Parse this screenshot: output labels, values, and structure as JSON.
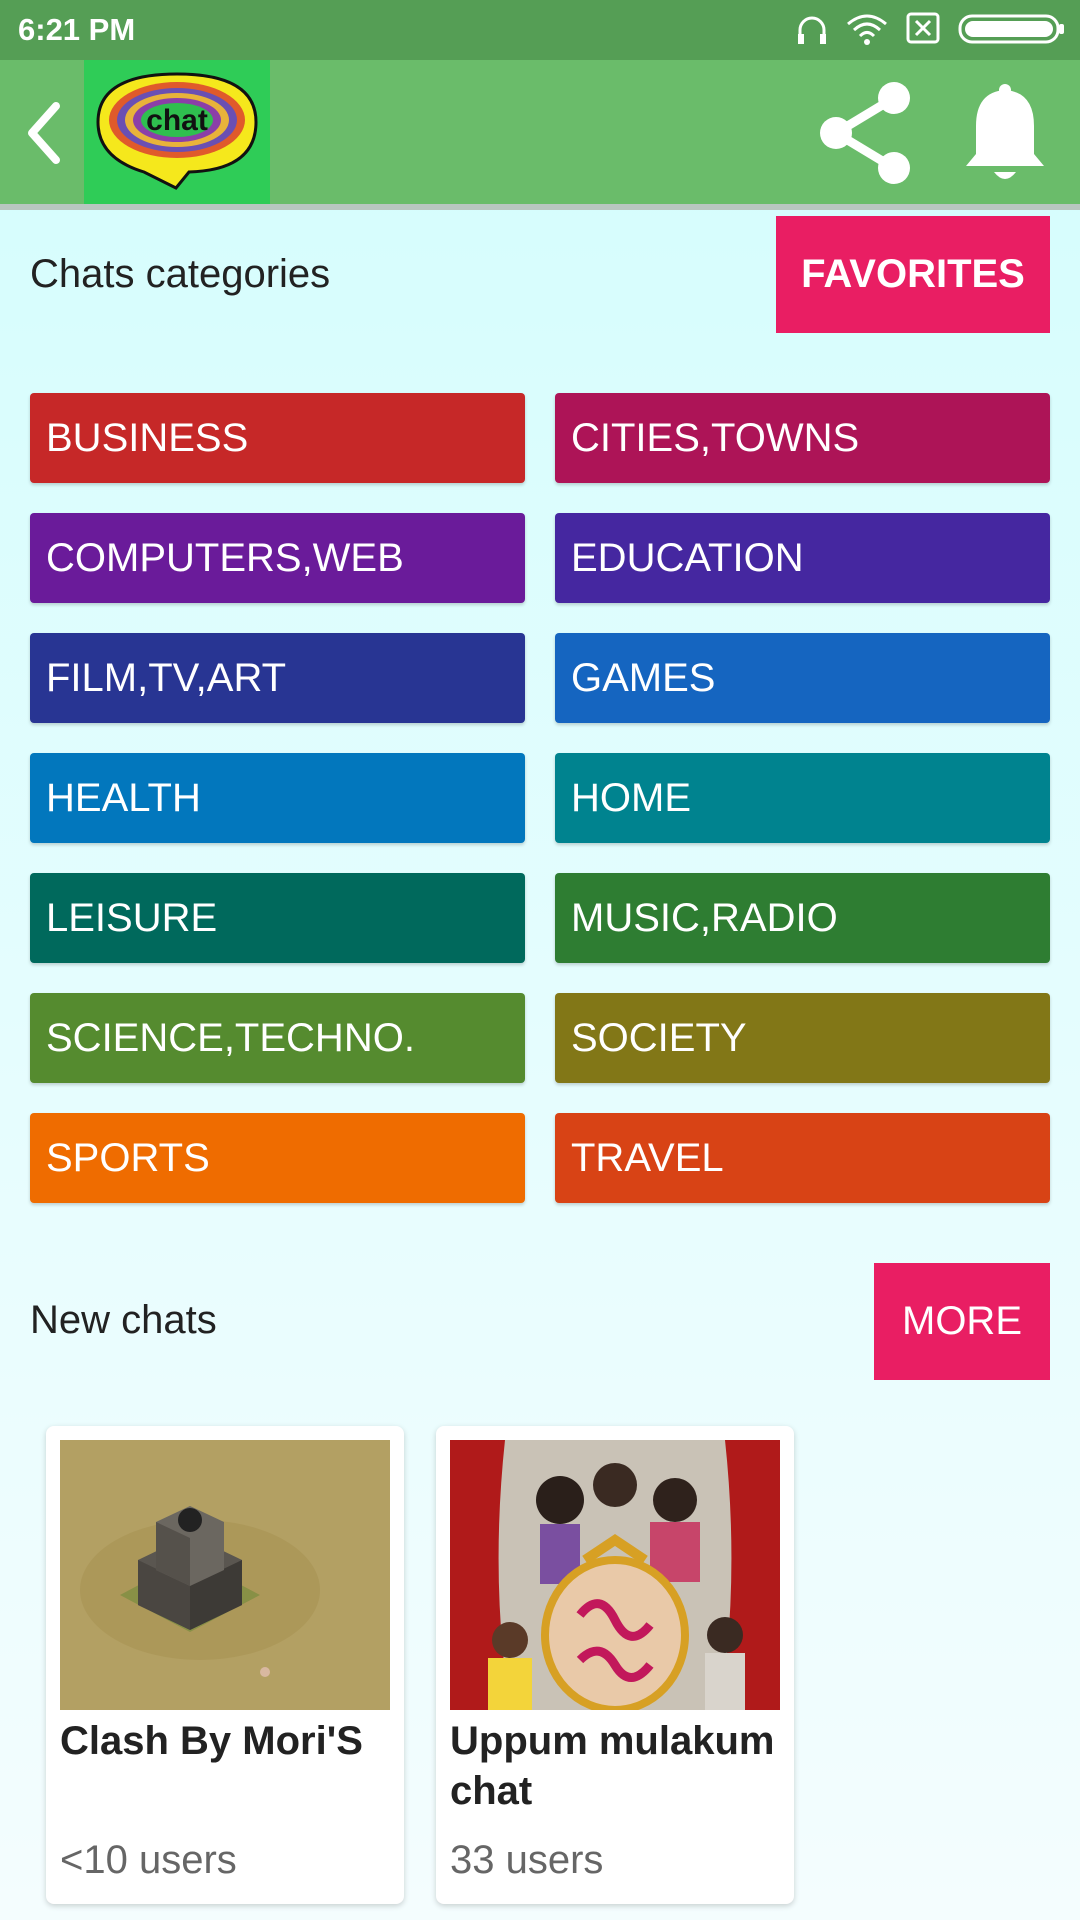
{
  "status_bar": {
    "time": "6:21 PM"
  },
  "app_bar": {
    "logo_text": "chat"
  },
  "categories_section": {
    "title": "Chats categories",
    "favorites_label": "FAVORITES",
    "items": [
      {
        "label": "BUSINESS",
        "color": "#c62828"
      },
      {
        "label": "CITIES,TOWNS",
        "color": "#ad1457"
      },
      {
        "label": "COMPUTERS,WEB",
        "color": "#6a1b9a"
      },
      {
        "label": "EDUCATION",
        "color": "#4527a0"
      },
      {
        "label": "FILM,TV,ART",
        "color": "#283593"
      },
      {
        "label": "GAMES",
        "color": "#1565c0"
      },
      {
        "label": "HEALTH",
        "color": "#0277bd"
      },
      {
        "label": "HOME",
        "color": "#00838f"
      },
      {
        "label": "LEISURE",
        "color": "#00695c"
      },
      {
        "label": "MUSIC,RADIO",
        "color": "#2e7d32"
      },
      {
        "label": "SCIENCE,TECHNO.",
        "color": "#558b2f"
      },
      {
        "label": "SOCIETY",
        "color": "#827717"
      },
      {
        "label": "SPORTS",
        "color": "#ef6c00"
      },
      {
        "label": "TRAVEL",
        "color": "#d84315"
      }
    ]
  },
  "new_chats_section": {
    "title": "New chats",
    "more_label": "MORE",
    "cards": [
      {
        "title": "Clash By Mori'S",
        "users": "<10 users"
      },
      {
        "title": "Uppum mulakum chat",
        "users": "33 users"
      }
    ]
  },
  "colors": {
    "accent": "#e91e63",
    "app_bar": "#6abc6a",
    "status_bar": "#559e55"
  }
}
